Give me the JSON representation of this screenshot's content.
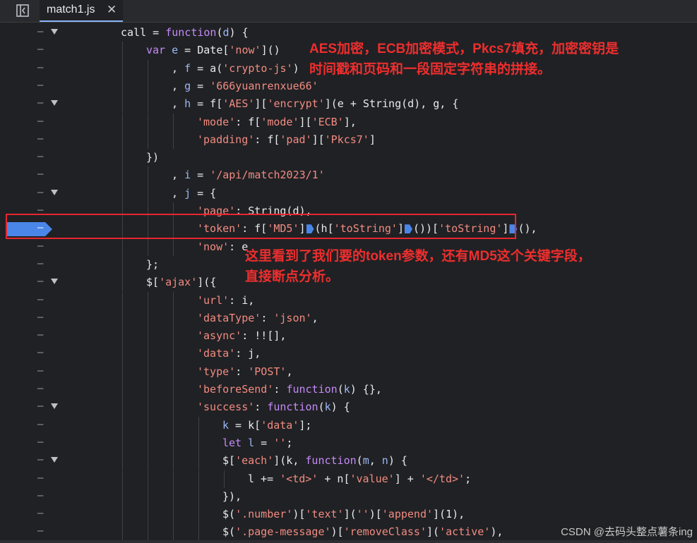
{
  "tab": {
    "filename": "match1.js",
    "close_glyph": "✕"
  },
  "toggle_icon": "sidebar-toggle-icon",
  "breakpoint": {
    "line": 12,
    "color": "#4a86e8"
  },
  "code_lines": [
    {
      "indent": 0,
      "fold": true,
      "segments": [
        [
          "p",
          "call = "
        ],
        [
          "kw",
          "function"
        ],
        [
          "p",
          "("
        ],
        [
          "var",
          "d"
        ],
        [
          "p",
          ") {"
        ]
      ]
    },
    {
      "indent": 1,
      "fold": false,
      "segments": [
        [
          "kw",
          "var "
        ],
        [
          "var",
          "e"
        ],
        [
          "p",
          " = Date["
        ],
        [
          "str",
          "'now'"
        ],
        [
          "p",
          "]()"
        ]
      ]
    },
    {
      "indent": 2,
      "fold": false,
      "segments": [
        [
          "p",
          ", "
        ],
        [
          "var",
          "f"
        ],
        [
          "p",
          " = a("
        ],
        [
          "str",
          "'crypto-js'"
        ],
        [
          "p",
          ")"
        ]
      ]
    },
    {
      "indent": 2,
      "fold": false,
      "segments": [
        [
          "p",
          ", "
        ],
        [
          "var",
          "g"
        ],
        [
          "p",
          " = "
        ],
        [
          "str",
          "'666yuanrenxue66'"
        ]
      ]
    },
    {
      "indent": 2,
      "fold": true,
      "segments": [
        [
          "p",
          ", "
        ],
        [
          "var",
          "h"
        ],
        [
          "p",
          " = f["
        ],
        [
          "str",
          "'AES'"
        ],
        [
          "p",
          "]["
        ],
        [
          "str",
          "'encrypt'"
        ],
        [
          "p",
          "](e + String(d), g, {"
        ]
      ]
    },
    {
      "indent": 3,
      "fold": false,
      "segments": [
        [
          "str",
          "'mode'"
        ],
        [
          "p",
          ": f["
        ],
        [
          "str",
          "'mode'"
        ],
        [
          "p",
          "]["
        ],
        [
          "str",
          "'ECB'"
        ],
        [
          "p",
          "],"
        ]
      ]
    },
    {
      "indent": 3,
      "fold": false,
      "segments": [
        [
          "str",
          "'padding'"
        ],
        [
          "p",
          ": f["
        ],
        [
          "str",
          "'pad'"
        ],
        [
          "p",
          "]["
        ],
        [
          "str",
          "'Pkcs7'"
        ],
        [
          "p",
          "]"
        ]
      ]
    },
    {
      "indent": 1,
      "fold": false,
      "segments": [
        [
          "p",
          "})"
        ]
      ]
    },
    {
      "indent": 2,
      "fold": false,
      "segments": [
        [
          "p",
          ", "
        ],
        [
          "var",
          "i"
        ],
        [
          "p",
          " = "
        ],
        [
          "str",
          "'/api/match2023/1'"
        ]
      ]
    },
    {
      "indent": 2,
      "fold": true,
      "segments": [
        [
          "p",
          ", "
        ],
        [
          "var",
          "j"
        ],
        [
          "p",
          " = {"
        ]
      ]
    },
    {
      "indent": 3,
      "fold": false,
      "segments": [
        [
          "str",
          "'page'"
        ],
        [
          "p",
          ": String(d),"
        ]
      ]
    },
    {
      "indent": 3,
      "fold": false,
      "segments": [
        [
          "str",
          "'token'"
        ],
        [
          "p",
          ": f["
        ],
        [
          "str",
          "'MD5'"
        ],
        [
          "p",
          "]"
        ],
        [
          "bp",
          ""
        ],
        [
          "p",
          "(h["
        ],
        [
          "str",
          "'toString'"
        ],
        [
          "p",
          "]"
        ],
        [
          "bp",
          ""
        ],
        [
          "p",
          "())["
        ],
        [
          "str",
          "'toString'"
        ],
        [
          "p",
          "]"
        ],
        [
          "bp",
          ""
        ],
        [
          "p",
          "(),"
        ]
      ]
    },
    {
      "indent": 3,
      "fold": false,
      "segments": [
        [
          "str",
          "'now'"
        ],
        [
          "p",
          ": e"
        ]
      ]
    },
    {
      "indent": 1,
      "fold": false,
      "segments": [
        [
          "p",
          "};"
        ]
      ]
    },
    {
      "indent": 1,
      "fold": true,
      "segments": [
        [
          "p",
          "$["
        ],
        [
          "str",
          "'ajax'"
        ],
        [
          "p",
          "]({"
        ]
      ]
    },
    {
      "indent": 3,
      "fold": false,
      "segments": [
        [
          "str",
          "'url'"
        ],
        [
          "p",
          ": i,"
        ]
      ]
    },
    {
      "indent": 3,
      "fold": false,
      "segments": [
        [
          "str",
          "'dataType'"
        ],
        [
          "p",
          ": "
        ],
        [
          "str",
          "'json'"
        ],
        [
          "p",
          ","
        ]
      ]
    },
    {
      "indent": 3,
      "fold": false,
      "segments": [
        [
          "str",
          "'async'"
        ],
        [
          "p",
          ": !![],"
        ]
      ]
    },
    {
      "indent": 3,
      "fold": false,
      "segments": [
        [
          "str",
          "'data'"
        ],
        [
          "p",
          ": j,"
        ]
      ]
    },
    {
      "indent": 3,
      "fold": false,
      "segments": [
        [
          "str",
          "'type'"
        ],
        [
          "p",
          ": "
        ],
        [
          "str",
          "'POST'"
        ],
        [
          "p",
          ","
        ]
      ]
    },
    {
      "indent": 3,
      "fold": false,
      "segments": [
        [
          "str",
          "'beforeSend'"
        ],
        [
          "p",
          ": "
        ],
        [
          "kw",
          "function"
        ],
        [
          "p",
          "("
        ],
        [
          "var",
          "k"
        ],
        [
          "p",
          ") {},"
        ]
      ]
    },
    {
      "indent": 3,
      "fold": true,
      "segments": [
        [
          "str",
          "'success'"
        ],
        [
          "p",
          ": "
        ],
        [
          "kw",
          "function"
        ],
        [
          "p",
          "("
        ],
        [
          "var",
          "k"
        ],
        [
          "p",
          ") {"
        ]
      ]
    },
    {
      "indent": 4,
      "fold": false,
      "segments": [
        [
          "var",
          "k"
        ],
        [
          "p",
          " = k["
        ],
        [
          "str",
          "'data'"
        ],
        [
          "p",
          "];"
        ]
      ]
    },
    {
      "indent": 4,
      "fold": false,
      "segments": [
        [
          "kw",
          "let "
        ],
        [
          "var",
          "l"
        ],
        [
          "p",
          " = "
        ],
        [
          "str",
          "''"
        ],
        [
          "p",
          ";"
        ]
      ]
    },
    {
      "indent": 4,
      "fold": true,
      "segments": [
        [
          "p",
          "$["
        ],
        [
          "str",
          "'each'"
        ],
        [
          "p",
          "](k, "
        ],
        [
          "kw",
          "function"
        ],
        [
          "p",
          "("
        ],
        [
          "var",
          "m"
        ],
        [
          "p",
          ", "
        ],
        [
          "var",
          "n"
        ],
        [
          "p",
          ") {"
        ]
      ]
    },
    {
      "indent": 5,
      "fold": false,
      "segments": [
        [
          "p",
          "l += "
        ],
        [
          "str",
          "'<td>'"
        ],
        [
          "p",
          " + n["
        ],
        [
          "str",
          "'value'"
        ],
        [
          "p",
          "] + "
        ],
        [
          "str",
          "'</td>'"
        ],
        [
          "p",
          ";"
        ]
      ]
    },
    {
      "indent": 4,
      "fold": false,
      "segments": [
        [
          "p",
          "}),"
        ]
      ]
    },
    {
      "indent": 4,
      "fold": false,
      "segments": [
        [
          "p",
          "$("
        ],
        [
          "str",
          "'.number'"
        ],
        [
          "p",
          ")["
        ],
        [
          "str",
          "'text'"
        ],
        [
          "p",
          "]("
        ],
        [
          "str",
          "''"
        ],
        [
          "p",
          ")["
        ],
        [
          "str",
          "'append'"
        ],
        [
          "p",
          "](1),"
        ]
      ]
    },
    {
      "indent": 4,
      "fold": false,
      "segments": [
        [
          "p",
          "$("
        ],
        [
          "str",
          "'.page-message'"
        ],
        [
          "p",
          ")["
        ],
        [
          "str",
          "'removeClass'"
        ],
        [
          "p",
          "]("
        ],
        [
          "str",
          "'active'"
        ],
        [
          "p",
          "),"
        ]
      ]
    }
  ],
  "annotations": {
    "aes_line1": "AES加密，ECB加密模式，Pkcs7填充，加密密钥是",
    "aes_line2": "时间戳和页码和一段固定字符串的拼接。",
    "token_line1": "这里看到了我们要的token参数，还有MD5这个关键字段，",
    "token_line2": "直接断点分析。"
  },
  "watermark": "CSDN @去码头整点薯条ing"
}
